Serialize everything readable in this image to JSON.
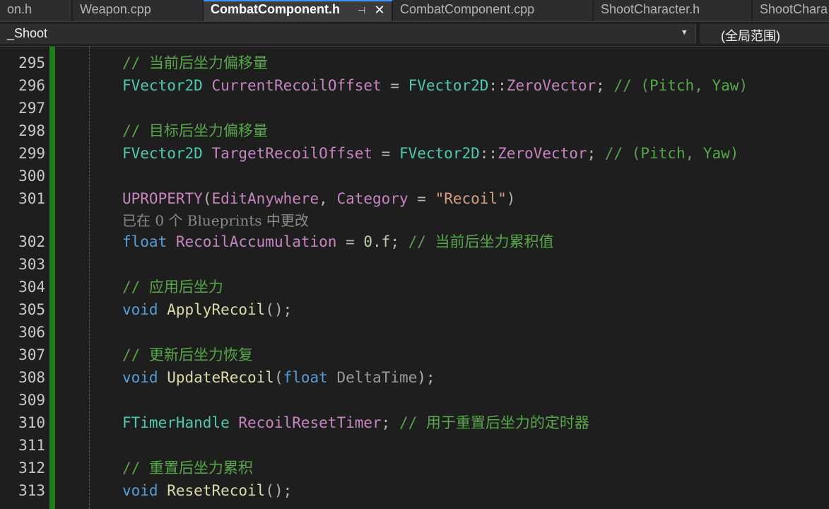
{
  "tabs": [
    {
      "label": "on.h"
    },
    {
      "label": "Weapon.cpp"
    },
    {
      "label": "CombatComponent.h",
      "active": true,
      "pin_glyph": "⊣",
      "close_glyph": "✕"
    },
    {
      "label": "CombatComponent.cpp"
    },
    {
      "label": "ShootCharacter.h"
    },
    {
      "label": "ShootChara"
    }
  ],
  "nav": {
    "scope": "_Shoot",
    "scope_arrow": "▼",
    "member": "(全局范围)"
  },
  "code_lines": {
    "l295": {
      "num": "295",
      "comment": "// 当前后坐力偏移量"
    },
    "l296": {
      "num": "296",
      "t1": "FVector2D",
      "t2": " ",
      "t3": "CurrentRecoilOffset",
      "t4": " = ",
      "t5": "FVector2D",
      "t6": "::",
      "t7": "ZeroVector",
      "t8": "; ",
      "t9": "// (Pitch, Yaw)"
    },
    "l297": {
      "num": "297"
    },
    "l298": {
      "num": "298",
      "comment": "// 目标后坐力偏移量"
    },
    "l299": {
      "num": "299",
      "t1": "FVector2D",
      "t2": " ",
      "t3": "TargetRecoilOffset",
      "t4": " = ",
      "t5": "FVector2D",
      "t6": "::",
      "t7": "ZeroVector",
      "t8": "; ",
      "t9": "// (Pitch, Yaw)"
    },
    "l300": {
      "num": "300"
    },
    "l301": {
      "num": "301",
      "t1": "UPROPERTY",
      "t2": "(",
      "t3": "EditAnywhere",
      "t4": ", ",
      "t5": "Category",
      "t6": " = ",
      "t7": "\"Recoil\"",
      "t8": ")",
      "hint": "已在 0 个 Blueprints 中更改"
    },
    "l302": {
      "num": "302",
      "t1": "float",
      "t2": " ",
      "t3": "RecoilAccumulation",
      "t4": " = ",
      "t5": "0.f",
      "t6": "; ",
      "t7": "// 当前后坐力累积值"
    },
    "l303": {
      "num": "303"
    },
    "l304": {
      "num": "304",
      "comment": "// 应用后坐力"
    },
    "l305": {
      "num": "305",
      "t1": "void",
      "t2": " ",
      "t3": "ApplyRecoil",
      "t4": "();"
    },
    "l306": {
      "num": "306"
    },
    "l307": {
      "num": "307",
      "comment": "// 更新后坐力恢复"
    },
    "l308": {
      "num": "308",
      "t1": "void",
      "t2": " ",
      "t3": "UpdateRecoil",
      "t4": "(",
      "t5": "float",
      "t6": " ",
      "t7": "DeltaTime",
      "t8": ");"
    },
    "l309": {
      "num": "309"
    },
    "l310": {
      "num": "310",
      "t1": "FTimerHandle",
      "t2": " ",
      "t3": "RecoilResetTimer",
      "t4": "; ",
      "t5": "// 用于重置后坐力的定时器"
    },
    "l311": {
      "num": "311"
    },
    "l312": {
      "num": "312",
      "comment": "// 重置后坐力累积"
    },
    "l313": {
      "num": "313",
      "t1": "void",
      "t2": " ",
      "t3": "ResetRecoil",
      "t4": "();"
    }
  },
  "colors": {
    "background": "#1e1e1e",
    "comment": "#57a64a",
    "type": "#4ec9b0",
    "keyword": "#569cd6",
    "macro": "#c586c0",
    "string": "#d69d85",
    "function": "#dcdcaa",
    "change_bar": "#1e7e1e",
    "active_tab_accent": "#3794ff"
  }
}
